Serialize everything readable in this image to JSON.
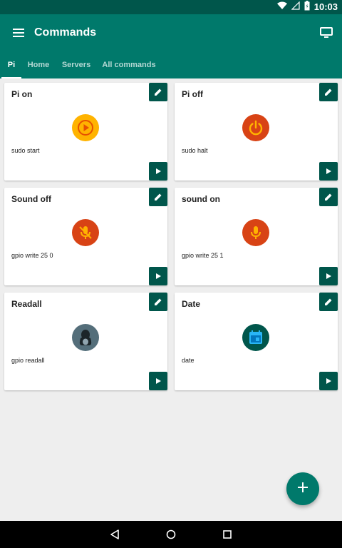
{
  "status_bar": {
    "time": "10:03",
    "icons": [
      "wifi-icon",
      "signal-icon",
      "battery-icon"
    ]
  },
  "app_bar": {
    "title": "Commands",
    "menu_icon": "menu-icon",
    "action_icon": "monitor-icon"
  },
  "tabs": [
    {
      "label": "Pi",
      "active": true
    },
    {
      "label": "Home",
      "active": false
    },
    {
      "label": "Servers",
      "active": false
    },
    {
      "label": "All commands",
      "active": false
    }
  ],
  "cards": [
    {
      "title": "Pi on",
      "command": "sudo start",
      "icon": "play-circle-icon",
      "icon_color": "#ffb300"
    },
    {
      "title": "Pi off",
      "command": "sudo halt",
      "icon": "power-icon",
      "icon_color": "#d84315"
    },
    {
      "title": "Sound off",
      "command": "gpio write 25 0",
      "icon": "mic-off-icon",
      "icon_color": "#d84315"
    },
    {
      "title": "sound on",
      "command": "gpio write 25 1",
      "icon": "mic-icon",
      "icon_color": "#d84315"
    },
    {
      "title": "Readall",
      "command": "gpio readall",
      "icon": "linux-tux-icon",
      "icon_color": "#546e7a"
    },
    {
      "title": "Date",
      "command": "date",
      "icon": "calendar-icon",
      "icon_color": "#00564b"
    }
  ],
  "fab": {
    "icon": "plus-icon"
  },
  "nav_bar": {
    "icons": [
      "back-icon",
      "home-icon",
      "recents-icon"
    ]
  },
  "colors": {
    "primary": "#00796b",
    "primary_dark": "#00564b",
    "background": "#eeeeee",
    "card": "#ffffff"
  }
}
